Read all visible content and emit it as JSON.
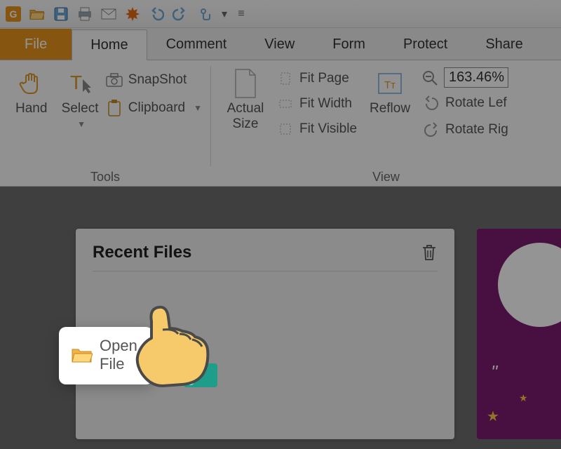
{
  "qat": {
    "items": [
      "app-icon",
      "open-icon",
      "save-icon",
      "print-icon",
      "email-icon",
      "new-icon",
      "undo-icon",
      "redo-icon",
      "touch-mode-icon",
      "customize-icon"
    ]
  },
  "tabs": {
    "file": "File",
    "items": [
      "Home",
      "Comment",
      "View",
      "Form",
      "Protect",
      "Share"
    ],
    "active": "Home"
  },
  "ribbon": {
    "tools": {
      "label": "Tools",
      "hand": "Hand",
      "select": "Select",
      "snapshot": "SnapShot",
      "clipboard": "Clipboard"
    },
    "view": {
      "label": "View",
      "actual_size": "Actual\nSize",
      "fit_page": "Fit Page",
      "fit_width": "Fit Width",
      "fit_visible": "Fit Visible",
      "reflow": "Reflow",
      "zoom_value": "163.46%",
      "rotate_left": "Rotate Lef",
      "rotate_right": "Rotate Rig"
    }
  },
  "start": {
    "recent_title": "Recent Files",
    "open_file": "Open File"
  },
  "sidecard": {
    "quote": "\""
  }
}
